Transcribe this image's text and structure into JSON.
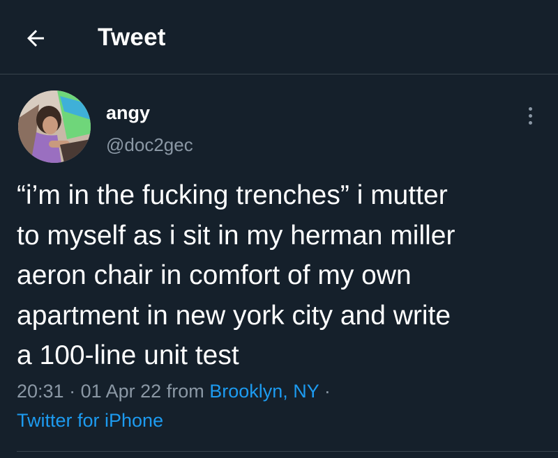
{
  "header": {
    "title": "Tweet",
    "back_icon": "arrow-left-icon"
  },
  "author": {
    "display_name": "angy",
    "handle": "@doc2gec",
    "avatar_icon": "user-avatar",
    "more_icon": "vertical-dots-icon"
  },
  "tweet": {
    "text": "“i’m in the fucking trenches” i mutter\nto myself as i sit in my herman miller\naeron chair in comfort of my own\napartment in new york city and write\na 100-line unit test"
  },
  "meta": {
    "time": "20:31",
    "separator": "·",
    "date": "01 Apr 22",
    "from_label": "from",
    "location": "Brooklyn, NY",
    "source": "Twitter for iPhone"
  },
  "colors": {
    "background": "#15202b",
    "text": "#ffffff",
    "muted": "#8b98a5",
    "link": "#1d9bf0",
    "divider": "#38444d"
  }
}
